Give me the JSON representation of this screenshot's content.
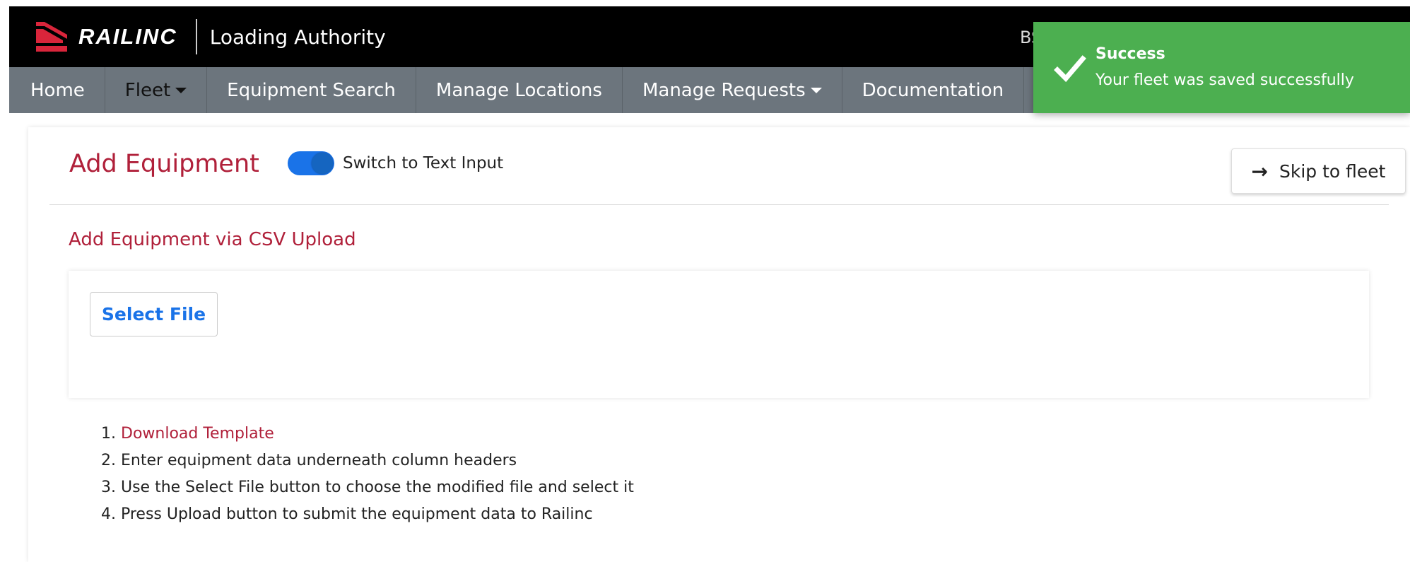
{
  "header": {
    "brand_name": "RAILINC",
    "app_title": "Loading Authority",
    "user_initials": "BS"
  },
  "nav": {
    "items": [
      {
        "label": "Home",
        "has_caret": false
      },
      {
        "label": "Fleet",
        "has_caret": true,
        "active": true
      },
      {
        "label": "Equipment Search",
        "has_caret": false
      },
      {
        "label": "Manage Locations",
        "has_caret": false
      },
      {
        "label": "Manage Requests",
        "has_caret": true
      },
      {
        "label": "Documentation",
        "has_caret": false
      }
    ]
  },
  "toast": {
    "title": "Success",
    "message": "Your fleet was saved successfully",
    "icon": "checkmark-icon",
    "color": "#4caf50"
  },
  "page": {
    "title": "Add Equipment",
    "toggle_label": "Switch to Text Input",
    "toggle_on": true,
    "skip_button": "Skip to fleet"
  },
  "upload": {
    "section_title": "Add Equipment via CSV Upload",
    "select_file_label": "Select File"
  },
  "steps": {
    "s1_num": "1.",
    "s1_link": "Download Template",
    "s2": "2. Enter equipment data underneath column headers",
    "s3": "3. Use the Select File button to choose the modified file and select it",
    "s4": "4. Press Upload button to submit the equipment data to Railinc"
  },
  "colors": {
    "accent": "#b0203a",
    "primary": "#1a73e8",
    "nav_bg": "#6c757d",
    "topbar_bg": "#000000"
  }
}
